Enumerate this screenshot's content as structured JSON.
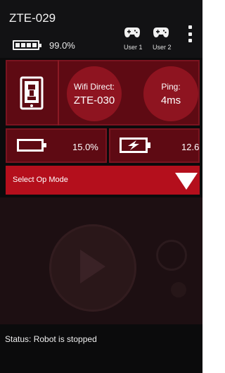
{
  "app": {
    "title": "ZTE-029"
  },
  "phone_status": {
    "battery_percent": "99.0%",
    "battery_level": 0.99
  },
  "gamepads": [
    {
      "label": "User 1"
    },
    {
      "label": "User 2"
    }
  ],
  "network": {
    "wifi_label": "Wifi Direct:",
    "wifi_value": "ZTE-030",
    "ping_label": "Ping:",
    "ping_value": "4ms"
  },
  "robot_battery": {
    "value": "15.0%"
  },
  "robot_voltage": {
    "value": "12.6"
  },
  "op_mode": {
    "label": "Select Op Mode"
  },
  "status": {
    "text": "Status: Robot is stopped"
  },
  "colors": {
    "accent_red": "#b40f1c",
    "panel_red": "#5e0a13",
    "circle_red": "#8e1420",
    "background": "#0b0b0c"
  },
  "icons": [
    "phone-battery-icon",
    "gamepad-icon",
    "more-options-icon",
    "robot-phone-icon",
    "battery-icon",
    "charging-battery-icon",
    "dropdown-arrow-icon",
    "play-icon"
  ]
}
